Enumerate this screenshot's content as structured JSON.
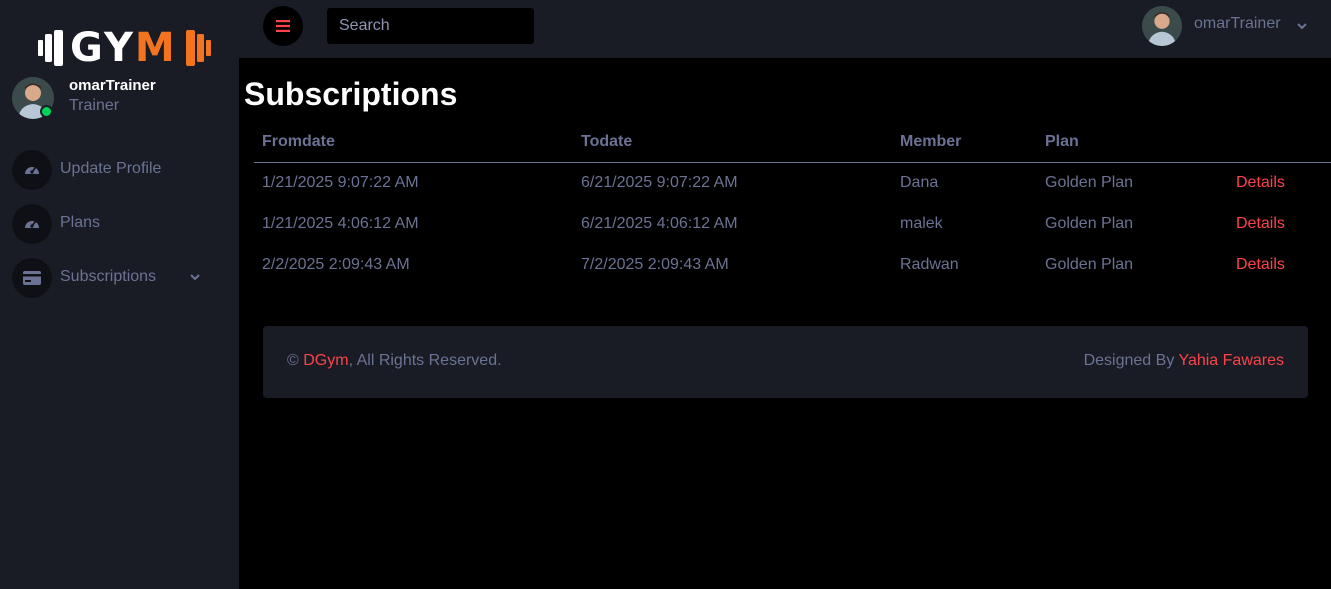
{
  "brand": {
    "logo_text": "GY",
    "logo_accent": "M",
    "accent_color": "#fc424a",
    "logo_color": "#f4731f"
  },
  "sidebar": {
    "profile": {
      "name": "omarTrainer",
      "role": "Trainer"
    },
    "items": [
      {
        "label": "Update Profile",
        "icon": "speedometer-icon"
      },
      {
        "label": "Plans",
        "icon": "speedometer-icon"
      },
      {
        "label": "Subscriptions",
        "icon": "card-icon",
        "has_chevron": true
      }
    ]
  },
  "topbar": {
    "search_placeholder": "Search",
    "username": "omarTrainer"
  },
  "main": {
    "title": "Subscriptions",
    "table": {
      "headers": [
        "Fromdate",
        "Todate",
        "Member",
        "Plan",
        ""
      ],
      "rows": [
        {
          "fromdate": "1/21/2025 9:07:22 AM",
          "todate": "6/21/2025 9:07:22 AM",
          "member": "Dana",
          "plan": "Golden Plan",
          "action": "Details"
        },
        {
          "fromdate": "1/21/2025 4:06:12 AM",
          "todate": "6/21/2025 4:06:12 AM",
          "member": "malek",
          "plan": "Golden Plan",
          "action": "Details"
        },
        {
          "fromdate": "2/2/2025 2:09:43 AM",
          "todate": "7/2/2025 2:09:43 AM",
          "member": "Radwan",
          "plan": "Golden Plan",
          "action": "Details"
        }
      ]
    }
  },
  "footer": {
    "copyright_symbol": "©",
    "brand_link": "DGym",
    "rights": ", All Rights Reserved.",
    "designed_by": "Designed By",
    "designer": "Yahia Fawares"
  }
}
